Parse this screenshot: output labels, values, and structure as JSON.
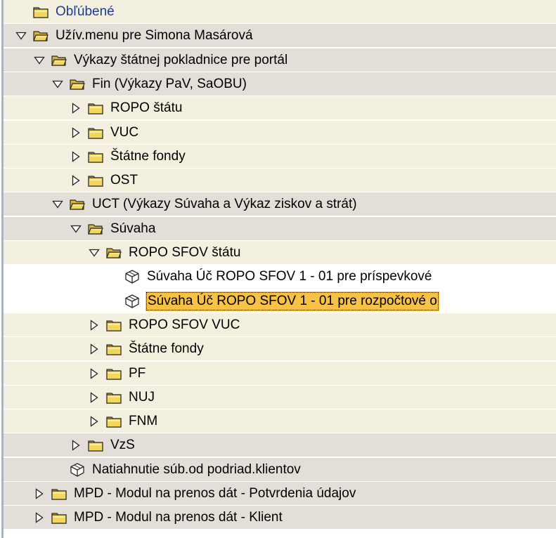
{
  "tree": [
    {
      "label": "Obľúbené",
      "level": 0,
      "expander": "none",
      "icon": "folder-closed-icon",
      "bg": "pale",
      "link": true
    },
    {
      "label": "Užív.menu pre Simona Masárová",
      "level": 0,
      "expander": "expanded",
      "icon": "folder-open-icon",
      "bg": "stone"
    },
    {
      "label": "Výkazy štátnej pokladnice pre portál",
      "level": 1,
      "expander": "expanded",
      "icon": "folder-open-icon",
      "bg": "stone"
    },
    {
      "label": "Fin (Výkazy PaV, SaOBU)",
      "level": 2,
      "expander": "expanded",
      "icon": "folder-open-icon",
      "bg": "stone"
    },
    {
      "label": "ROPO štátu",
      "level": 3,
      "expander": "collapsed",
      "icon": "folder-closed-icon",
      "bg": "pale"
    },
    {
      "label": "VUC",
      "level": 3,
      "expander": "collapsed",
      "icon": "folder-closed-icon",
      "bg": "pale"
    },
    {
      "label": "Štátne fondy",
      "level": 3,
      "expander": "collapsed",
      "icon": "folder-closed-icon",
      "bg": "pale"
    },
    {
      "label": "OST",
      "level": 3,
      "expander": "collapsed",
      "icon": "folder-closed-icon",
      "bg": "pale"
    },
    {
      "label": "UCT (Výkazy Súvaha a Výkaz ziskov a strát)",
      "level": 2,
      "expander": "expanded",
      "icon": "folder-open-icon",
      "bg": "stone"
    },
    {
      "label": "Súvaha",
      "level": 3,
      "expander": "expanded",
      "icon": "folder-open-icon",
      "bg": "stone"
    },
    {
      "label": "ROPO SFOV štátu",
      "level": 4,
      "expander": "expanded",
      "icon": "folder-open-icon",
      "bg": "pale"
    },
    {
      "label": "Súvaha Úč ROPO SFOV 1 - 01 pre príspevkové",
      "level": 5,
      "expander": "none",
      "icon": "transaction-cube-icon",
      "bg": "white"
    },
    {
      "label": "Súvaha Úč ROPO SFOV 1 - 01 pre rozpočtové o",
      "level": 5,
      "expander": "none",
      "icon": "transaction-cube-icon",
      "bg": "white",
      "selected": true
    },
    {
      "label": "ROPO SFOV VUC",
      "level": 4,
      "expander": "collapsed",
      "icon": "folder-closed-icon",
      "bg": "pale"
    },
    {
      "label": "Štátne fondy",
      "level": 4,
      "expander": "collapsed",
      "icon": "folder-closed-icon",
      "bg": "pale"
    },
    {
      "label": "PF",
      "level": 4,
      "expander": "collapsed",
      "icon": "folder-closed-icon",
      "bg": "pale"
    },
    {
      "label": "NUJ",
      "level": 4,
      "expander": "collapsed",
      "icon": "folder-closed-icon",
      "bg": "pale"
    },
    {
      "label": "FNM",
      "level": 4,
      "expander": "collapsed",
      "icon": "folder-closed-icon",
      "bg": "pale"
    },
    {
      "label": "VzS",
      "level": 3,
      "expander": "collapsed",
      "icon": "folder-closed-icon",
      "bg": "stone"
    },
    {
      "label": "Natiahnutie súb.od podriad.klientov",
      "level": 2,
      "expander": "none",
      "icon": "transaction-cube-icon",
      "bg": "stone"
    },
    {
      "label": "MPD - Modul na prenos dát - Potvrdenia údajov",
      "level": 1,
      "expander": "collapsed",
      "icon": "folder-closed-icon",
      "bg": "stone"
    },
    {
      "label": "MPD - Modul na prenos dát - Klient",
      "level": 1,
      "expander": "collapsed",
      "icon": "folder-closed-icon",
      "bg": "stone"
    }
  ]
}
